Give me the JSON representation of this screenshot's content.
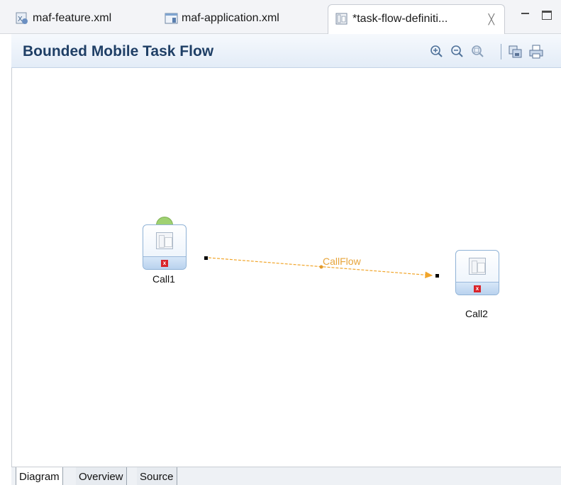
{
  "tabs": [
    {
      "label": "maf-feature.xml",
      "icon": "xml-feature-icon"
    },
    {
      "label": "maf-application.xml",
      "icon": "xml-application-icon"
    },
    {
      "label": "*task-flow-definiti...",
      "icon": "task-flow-icon",
      "active": true,
      "close": "╳"
    }
  ],
  "editor": {
    "title": "Bounded Mobile Task Flow",
    "tools": [
      "zoom-in-icon",
      "zoom-out-icon",
      "zoom-fit-icon",
      "save-image-icon",
      "print-icon"
    ]
  },
  "diagram": {
    "nodes": [
      {
        "label": "Call1",
        "type": "task-flow-call",
        "default_activity": true,
        "error": "x"
      },
      {
        "label": "Call2",
        "type": "task-flow-call",
        "default_activity": false,
        "error": "x"
      }
    ],
    "edge": {
      "label": "CallFlow",
      "color": "#e7a43a"
    }
  },
  "bottom_tabs": [
    {
      "label": "Diagram",
      "active": true
    },
    {
      "label": "Overview",
      "active": false
    },
    {
      "label": "Source",
      "active": false
    }
  ]
}
